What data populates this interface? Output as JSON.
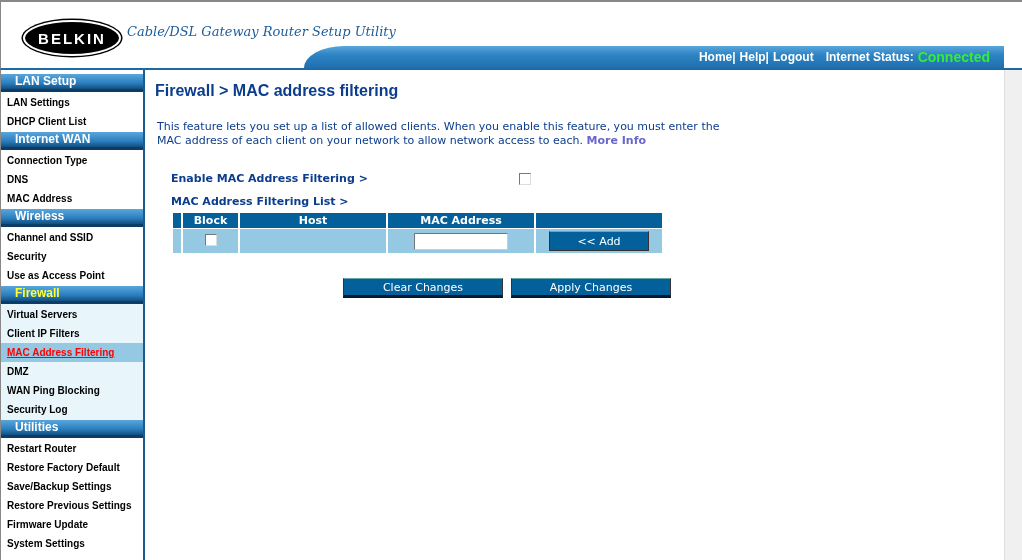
{
  "header": {
    "logo": "BELKIN",
    "tagline": "Cable/DSL Gateway Router Setup Utility",
    "links": [
      "Home|",
      "Help|",
      "Logout"
    ],
    "status_label": "Internet Status:",
    "status_value": "Connected"
  },
  "sidebar": {
    "sections": [
      {
        "title": "LAN Setup",
        "selected": false,
        "items": [
          {
            "label": "LAN Settings",
            "selected": false
          },
          {
            "label": "DHCP Client List",
            "selected": false
          }
        ]
      },
      {
        "title": "Internet WAN",
        "selected": false,
        "items": [
          {
            "label": "Connection Type",
            "selected": false
          },
          {
            "label": "DNS",
            "selected": false
          },
          {
            "label": "MAC Address",
            "selected": false
          }
        ]
      },
      {
        "title": "Wireless",
        "selected": false,
        "items": [
          {
            "label": "Channel and SSID",
            "selected": false
          },
          {
            "label": "Security",
            "selected": false
          },
          {
            "label": "Use as Access Point",
            "selected": false
          }
        ]
      },
      {
        "title": "Firewall",
        "selected": true,
        "items": [
          {
            "label": "Virtual Servers",
            "selected": false
          },
          {
            "label": "Client IP Filters",
            "selected": false
          },
          {
            "label": "MAC Address Filtering",
            "selected": true
          },
          {
            "label": "DMZ",
            "selected": false
          },
          {
            "label": "WAN Ping Blocking",
            "selected": false
          },
          {
            "label": "Security Log",
            "selected": false
          }
        ]
      },
      {
        "title": "Utilities",
        "selected": false,
        "items": [
          {
            "label": "Restart Router",
            "selected": false
          },
          {
            "label": "Restore Factory Default",
            "selected": false
          },
          {
            "label": "Save/Backup Settings",
            "selected": false
          },
          {
            "label": "Restore Previous Settings",
            "selected": false
          },
          {
            "label": "Firmware Update",
            "selected": false
          },
          {
            "label": "System Settings",
            "selected": false
          }
        ]
      }
    ]
  },
  "main": {
    "title": "Firewall > MAC address filtering",
    "description": "This feature lets you set up a list of allowed clients. When you enable this feature, you must enter the MAC address of each client on your network to allow network access to each.",
    "more_info": "More Info",
    "enable_label": "Enable MAC Address Filtering >",
    "enable_checked": false,
    "list_label": "MAC Address Filtering List >",
    "table": {
      "columns": [
        "Block",
        "Host",
        "MAC Address"
      ],
      "row": {
        "block_checked": false,
        "add_button": "<< Add"
      }
    },
    "buttons": [
      "Clear Changes",
      "Apply Changes"
    ]
  }
}
